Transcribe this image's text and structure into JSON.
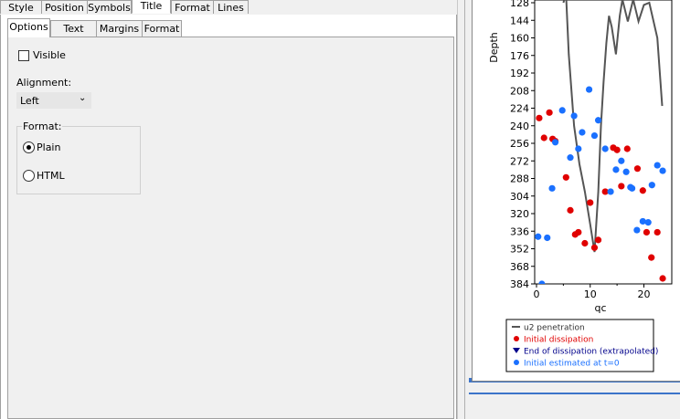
{
  "top_tabs": [
    "Style",
    "Position",
    "Symbols",
    "Title",
    "Format",
    "Lines"
  ],
  "active_top_tab": "Title",
  "sub_tabs": [
    "Options",
    "Text",
    "Margins",
    "Format"
  ],
  "active_sub_tab": "Options",
  "options": {
    "visible_label": "Visible",
    "visible_checked": false,
    "alignment_label": "Alignment:",
    "alignment_value": "Left",
    "format_group_label": "Format:",
    "format_plain_label": "Plain",
    "format_html_label": "HTML",
    "format_selected": "Plain"
  },
  "chart_data": {
    "type": "scatter",
    "ylabel": "Depth",
    "xlabel": "qc",
    "y_reversed": true,
    "ylim": [
      128,
      384
    ],
    "xlim": [
      0,
      24
    ],
    "y_ticks": [
      128,
      144,
      160,
      176,
      192,
      208,
      224,
      240,
      256,
      272,
      288,
      304,
      320,
      336,
      352,
      368,
      384
    ],
    "x_ticks": [
      0,
      10,
      20
    ],
    "legend_position": "bottom",
    "series": [
      {
        "name": "u2 penetration",
        "style": "line",
        "color": "#555555",
        "points": [
          [
            5,
            128
          ],
          [
            5.5,
            120
          ],
          [
            6,
            175
          ],
          [
            7,
            240
          ],
          [
            8,
            275
          ],
          [
            9,
            300
          ],
          [
            10,
            330
          ],
          [
            10.8,
            355
          ],
          [
            11,
            340
          ],
          [
            11.5,
            300
          ],
          [
            12,
            240
          ],
          [
            12.5,
            200
          ],
          [
            13,
            165
          ],
          [
            13.5,
            140
          ],
          [
            14,
            150
          ],
          [
            14.8,
            175
          ],
          [
            15.5,
            140
          ],
          [
            16,
            125
          ],
          [
            17,
            145
          ],
          [
            18,
            125
          ],
          [
            19,
            145
          ],
          [
            20,
            130
          ],
          [
            21,
            128
          ],
          [
            22.5,
            160
          ],
          [
            23.4,
            222
          ]
        ]
      },
      {
        "name": "Initial dissipation",
        "style": "point",
        "color": "#e00000",
        "points": [
          [
            0.5,
            233
          ],
          [
            1.4,
            251
          ],
          [
            2.4,
            228
          ],
          [
            3,
            252
          ],
          [
            3.5,
            254
          ],
          [
            5.5,
            287
          ],
          [
            6.3,
            317
          ],
          [
            7.2,
            339
          ],
          [
            7.8,
            337
          ],
          [
            9,
            347
          ],
          [
            10,
            310
          ],
          [
            10.8,
            351
          ],
          [
            11.5,
            344
          ],
          [
            12.8,
            300
          ],
          [
            14.3,
            260
          ],
          [
            15,
            262
          ],
          [
            15.8,
            295
          ],
          [
            16.9,
            261
          ],
          [
            18.8,
            279
          ],
          [
            19.8,
            299
          ],
          [
            20.5,
            337
          ],
          [
            21.4,
            360
          ],
          [
            22.5,
            337
          ],
          [
            23.5,
            379
          ]
        ]
      },
      {
        "name": "End of dissipation (extrapolated)",
        "style": "point",
        "color": "#00008b",
        "points": []
      },
      {
        "name": "Initial estimated at t=0",
        "style": "point",
        "color": "#1a70ff",
        "points": [
          [
            0.3,
            341
          ],
          [
            1,
            384
          ],
          [
            2,
            342
          ],
          [
            2.9,
            297
          ],
          [
            3.5,
            255
          ],
          [
            4.8,
            226
          ],
          [
            6.3,
            269
          ],
          [
            7,
            231
          ],
          [
            7.8,
            261
          ],
          [
            8.5,
            246
          ],
          [
            9.8,
            207
          ],
          [
            10.8,
            249
          ],
          [
            11.5,
            235
          ],
          [
            12.8,
            261
          ],
          [
            13.8,
            300
          ],
          [
            14.8,
            280
          ],
          [
            15.8,
            272
          ],
          [
            16.7,
            282
          ],
          [
            17.8,
            297
          ],
          [
            18.7,
            335
          ],
          [
            19.8,
            327
          ],
          [
            20.8,
            328
          ],
          [
            21.5,
            294
          ],
          [
            22.5,
            276
          ],
          [
            23.5,
            281
          ],
          [
            17.5,
            296
          ]
        ]
      }
    ]
  }
}
